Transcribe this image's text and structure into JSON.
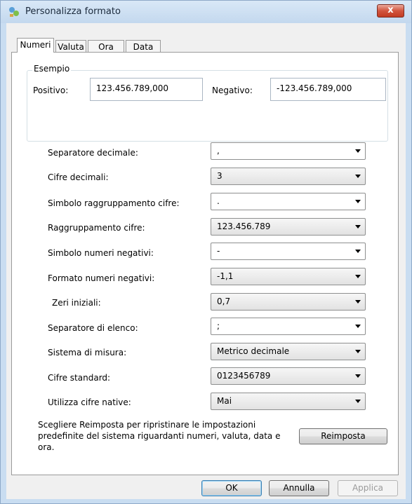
{
  "window": {
    "title": "Personalizza formato",
    "close_glyph": "x"
  },
  "tabs": [
    {
      "label": "Numeri",
      "active": true
    },
    {
      "label": "Valuta",
      "active": false
    },
    {
      "label": "Ora",
      "active": false
    },
    {
      "label": "Data",
      "active": false
    }
  ],
  "example": {
    "group_label": "Esempio",
    "positive_label": "Positivo:",
    "positive_value": "123.456.789,000",
    "negative_label": "Negativo:",
    "negative_value": "-123.456.789,000"
  },
  "settings": [
    {
      "label": "Separatore decimale:",
      "value": ","
    },
    {
      "label": "Cifre decimali:",
      "value": "3"
    },
    {
      "label": "Simbolo raggruppamento cifre:",
      "value": "."
    },
    {
      "label": "Raggruppamento cifre:",
      "value": "123.456.789"
    },
    {
      "label": "Simbolo numeri negativi:",
      "value": "-"
    },
    {
      "label": "Formato numeri negativi:",
      "value": "-1,1"
    },
    {
      "label": "Zeri iniziali:",
      "value": "0,7"
    },
    {
      "label": "Separatore di elenco:",
      "value": ";"
    },
    {
      "label": "Sistema di misura:",
      "value": "Metrico decimale"
    },
    {
      "label": "Cifre standard:",
      "value": "0123456789"
    },
    {
      "label": "Utilizza cifre native:",
      "value": "Mai"
    }
  ],
  "info_text": "Scegliere Reimposta per ripristinare le impostazioni predefinite del sistema riguardanti numeri, valuta, data e ora.",
  "buttons": {
    "reset": "Reimposta",
    "ok": "OK",
    "cancel": "Annulla",
    "apply": "Applica"
  },
  "colors": {
    "window_frame": "#c9ddf1",
    "close_button": "#c23b22"
  }
}
